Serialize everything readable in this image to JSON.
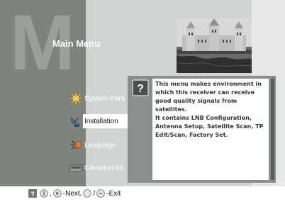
{
  "header": {
    "background_letter": "M",
    "title": "Main Menu"
  },
  "menu": {
    "items": [
      {
        "label": "System Para",
        "icon": "gear-icon"
      },
      {
        "label": "Installation",
        "icon": "satellite-dish-icon",
        "selected": true
      },
      {
        "label": "Language",
        "icon": "language-icon"
      },
      {
        "label": "Common Int",
        "icon": "card-slot-icon"
      }
    ]
  },
  "help": {
    "icon": "question-icon",
    "text": "This menu makes environment in\nwhich this receiver can receive\ngood quality signals from satellites.\n It contains LNB Configuration,\nAntenna Setup, Satellite Scan, TP\nEdit/Scan, Factory Set."
  },
  "footer": {
    "help_icon": "question-icon",
    "info_icon": "info-icon",
    "sep1": ",",
    "next_label": "-Next,",
    "exit_sep": "/",
    "exit_label": "-Exit"
  },
  "colors": {
    "left_panel": "#7e837e",
    "main_panel": "#d1d5d1",
    "popup_frame": "#8b8f8b",
    "highlight": "#ffffff"
  }
}
